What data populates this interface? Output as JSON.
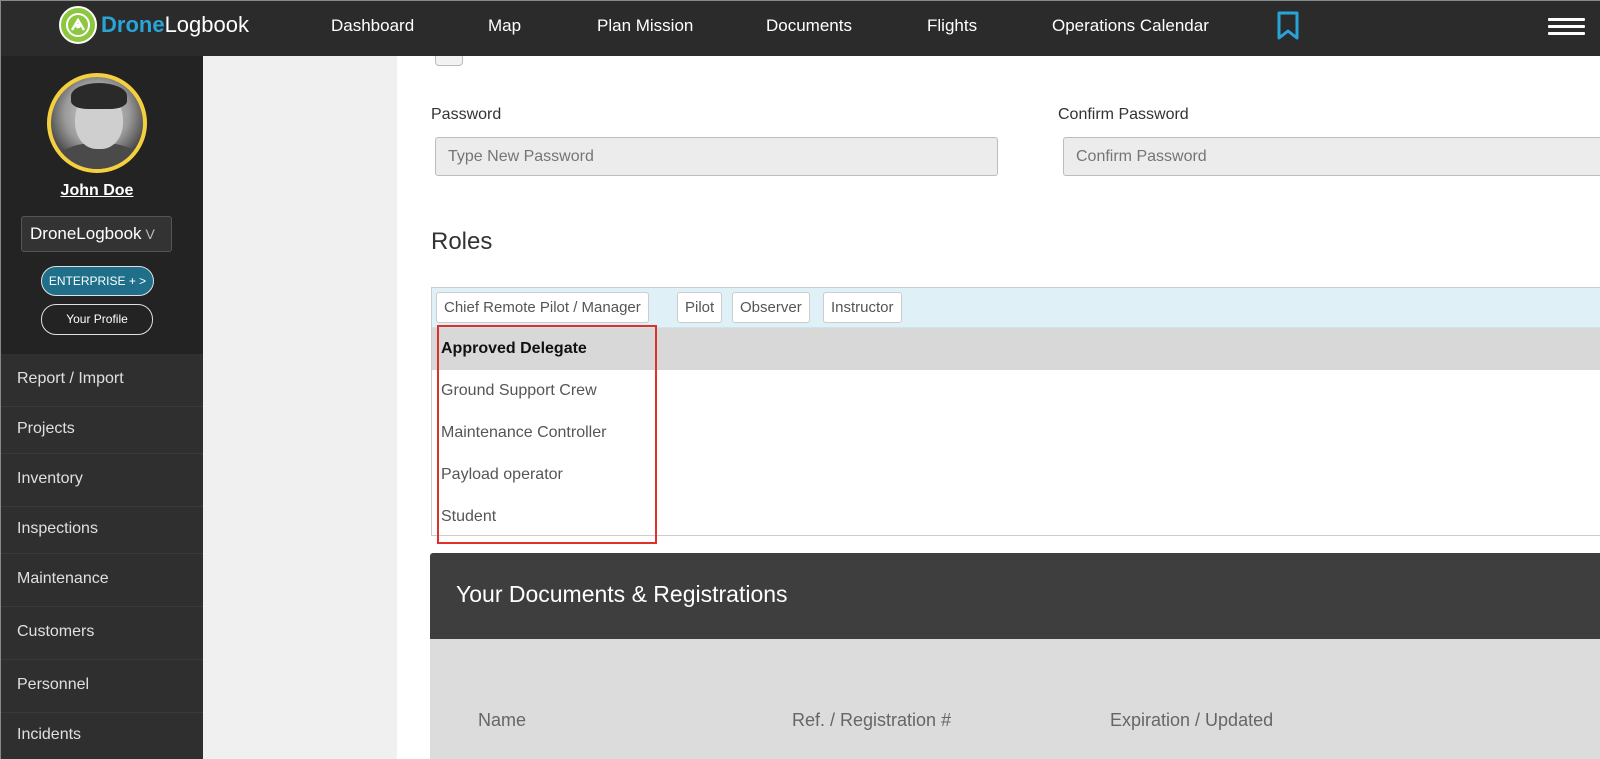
{
  "app": {
    "logo_drone": "Drone",
    "logo_logbook": "Logbook"
  },
  "nav": {
    "items": [
      {
        "label": "Dashboard"
      },
      {
        "label": "Map"
      },
      {
        "label": "Plan Mission"
      },
      {
        "label": "Documents"
      },
      {
        "label": "Flights"
      },
      {
        "label": "Operations Calendar"
      }
    ],
    "icons": [
      "bookmark-icon",
      "hamburger-menu-icon"
    ]
  },
  "sidebar": {
    "user_name": "John Doe",
    "org_select": "DroneLogbook",
    "org_chevron": "V",
    "enterprise_label": "ENTERPRISE + >",
    "profile_label": "Your Profile",
    "menu": [
      {
        "label": "Report / Import"
      },
      {
        "label": "Projects"
      },
      {
        "label": "Inventory"
      },
      {
        "label": "Inspections"
      },
      {
        "label": "Maintenance"
      },
      {
        "label": "Customers"
      },
      {
        "label": "Personnel"
      },
      {
        "label": "Incidents"
      }
    ]
  },
  "form": {
    "password_label": "Password",
    "password_placeholder": "Type New Password",
    "confirm_label": "Confirm Password",
    "confirm_placeholder": "Confirm Password"
  },
  "roles": {
    "title": "Roles",
    "selected": [
      {
        "label": "Chief Remote Pilot / Manager"
      },
      {
        "label": "Pilot"
      },
      {
        "label": "Observer"
      },
      {
        "label": "Instructor"
      }
    ],
    "options": [
      {
        "label": "Approved Delegate",
        "highlighted": true
      },
      {
        "label": "Ground Support Crew"
      },
      {
        "label": "Maintenance Controller"
      },
      {
        "label": "Payload operator"
      },
      {
        "label": "Student"
      }
    ]
  },
  "documents": {
    "title": "Your Documents & Registrations",
    "columns": [
      {
        "label": "Name"
      },
      {
        "label": "Ref. / Registration #"
      },
      {
        "label": "Expiration / Updated"
      }
    ]
  },
  "colors": {
    "topbar": "#2b2b2b",
    "brand_blue": "#29a4d9",
    "brand_green": "#8dc63f",
    "avatar_ring": "#f4d03f",
    "enterprise_btn": "#1f6f8b",
    "highlight_red": "#e0302a"
  }
}
